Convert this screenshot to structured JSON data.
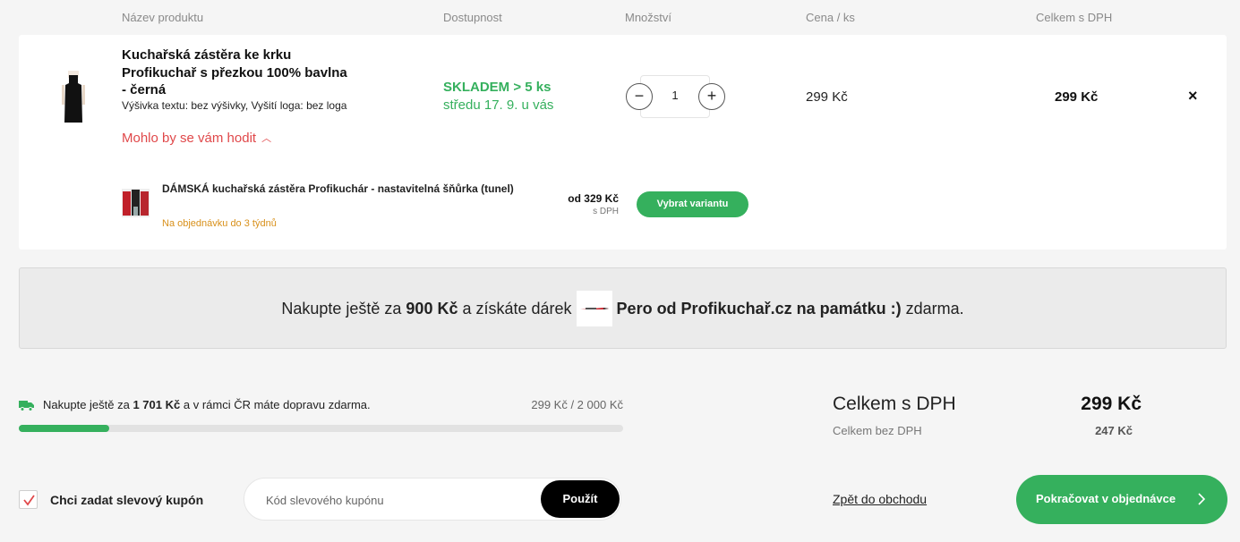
{
  "table_headers": {
    "product": "Název produktu",
    "availability": "Dostupnost",
    "quantity": "Množství",
    "unit_price": "Cena / ks",
    "total": "Celkem s DPH"
  },
  "item": {
    "title": "Kuchařská zástěra ke krku Profikuchař s přezkou 100% bavlna - černá",
    "variant": "Výšivka textu: bez výšivky, Vyšití loga: bez loga",
    "suggest_label": "Mohlo by se vám hodit",
    "stock": "SKLADEM > 5 ks",
    "delivery": "středu 17. 9. u vás",
    "quantity": "1",
    "minus": "−",
    "plus": "+",
    "unit_price": "299 Kč",
    "total_price": "299 Kč",
    "remove": "×",
    "image_icon": "apron-thumbnail"
  },
  "suggestion": {
    "title": "DÁMSKÁ kuchařská zástěra Profikuchár - nastavitelná šňůrka (tunel)",
    "availability": "Na objednávku do 3 týdnů",
    "price": "od 329 Kč",
    "vat_note": "s DPH",
    "button": "Vybrat variantu",
    "image_icon": "aprons-thumbnail"
  },
  "gift_banner": {
    "before": "Nakupte ještě za",
    "amount": "900 Kč",
    "middle": "a získáte dárek",
    "gift_name": "Pero od Profikuchař.cz na památku :)",
    "after": "zdarma.",
    "gift_icon": "pen-icon"
  },
  "shipping": {
    "before": "Nakupte ještě za",
    "amount": "1 701 Kč",
    "after": "a v rámci ČR máte dopravu zdarma.",
    "progress_text": "299 Kč / 2 000 Kč",
    "progress_fraction": 0.1495,
    "icon": "truck-icon"
  },
  "totals": {
    "with_vat_label": "Celkem s DPH",
    "with_vat_value": "299 Kč",
    "without_vat_label": "Celkem bez DPH",
    "without_vat_value": "247 Kč"
  },
  "coupon": {
    "checkbox_label": "Chci zadat slevový kupón",
    "checked": true,
    "placeholder": "Kód slevového kupónu",
    "apply": "Použít"
  },
  "actions": {
    "back": "Zpět do obchodu",
    "continue": "Pokračovat v objednávce",
    "continue_arrow": "›"
  },
  "colors": {
    "accent_green": "#35b05d",
    "suggest_red": "#e0484a",
    "availability_orange": "#d8901a"
  }
}
